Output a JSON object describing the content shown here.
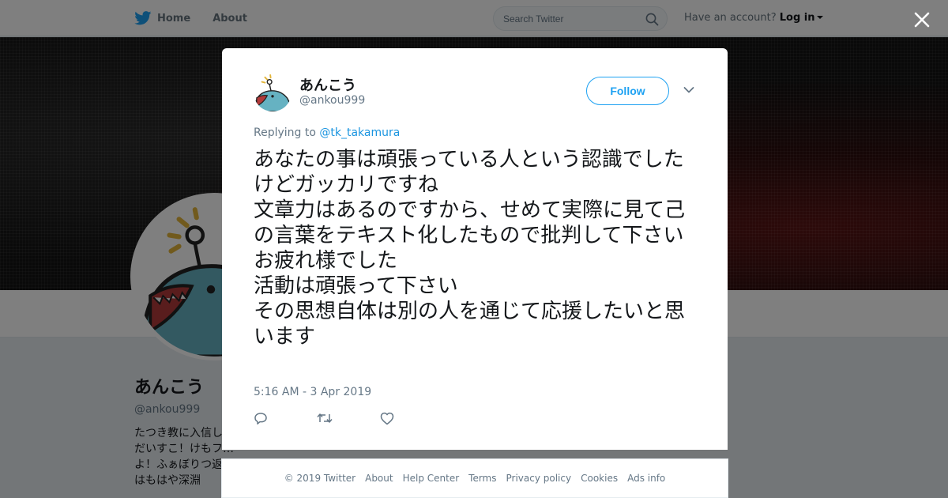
{
  "nav": {
    "home_label": "Home",
    "about_label": "About",
    "search_placeholder": "Search Twitter",
    "account_prompt": "Have an account?",
    "login_label": "Log in"
  },
  "profile": {
    "name": "あんこう",
    "handle": "@ankou999",
    "bio": "たつき教に入信し…\nだいすこ！けもフ…\nよ！ふぁぼりつ返…\nはもはや深淵"
  },
  "tweet": {
    "author_name": "あんこう",
    "author_handle": "@ankou999",
    "follow_label": "Follow",
    "replying_prefix": "Replying to",
    "replying_to": "@tk_takamura",
    "lines": [
      "あなたの事は頑張っている人という認識でしたけどガッカリですね",
      "文章力はあるのですから、せめて実際に見て己の言葉をテキスト化したもので批判して下さい",
      "お疲れ様でした",
      "活動は頑張って下さい",
      "その思想自体は別の人を通じて応援したいと思います"
    ],
    "timestamp": "5:16 AM - 3 Apr 2019",
    "actions": [
      {
        "name": "reply-icon"
      },
      {
        "name": "retweet-icon"
      },
      {
        "name": "like-icon"
      }
    ]
  },
  "footer": {
    "copyright": "© 2019 Twitter",
    "links": [
      "About",
      "Help Center",
      "Terms",
      "Privacy policy",
      "Cookies",
      "Ads info"
    ]
  },
  "colors": {
    "twitter_blue": "#1da1f2",
    "link_blue": "#1b95e0",
    "secondary_text": "#657786"
  }
}
